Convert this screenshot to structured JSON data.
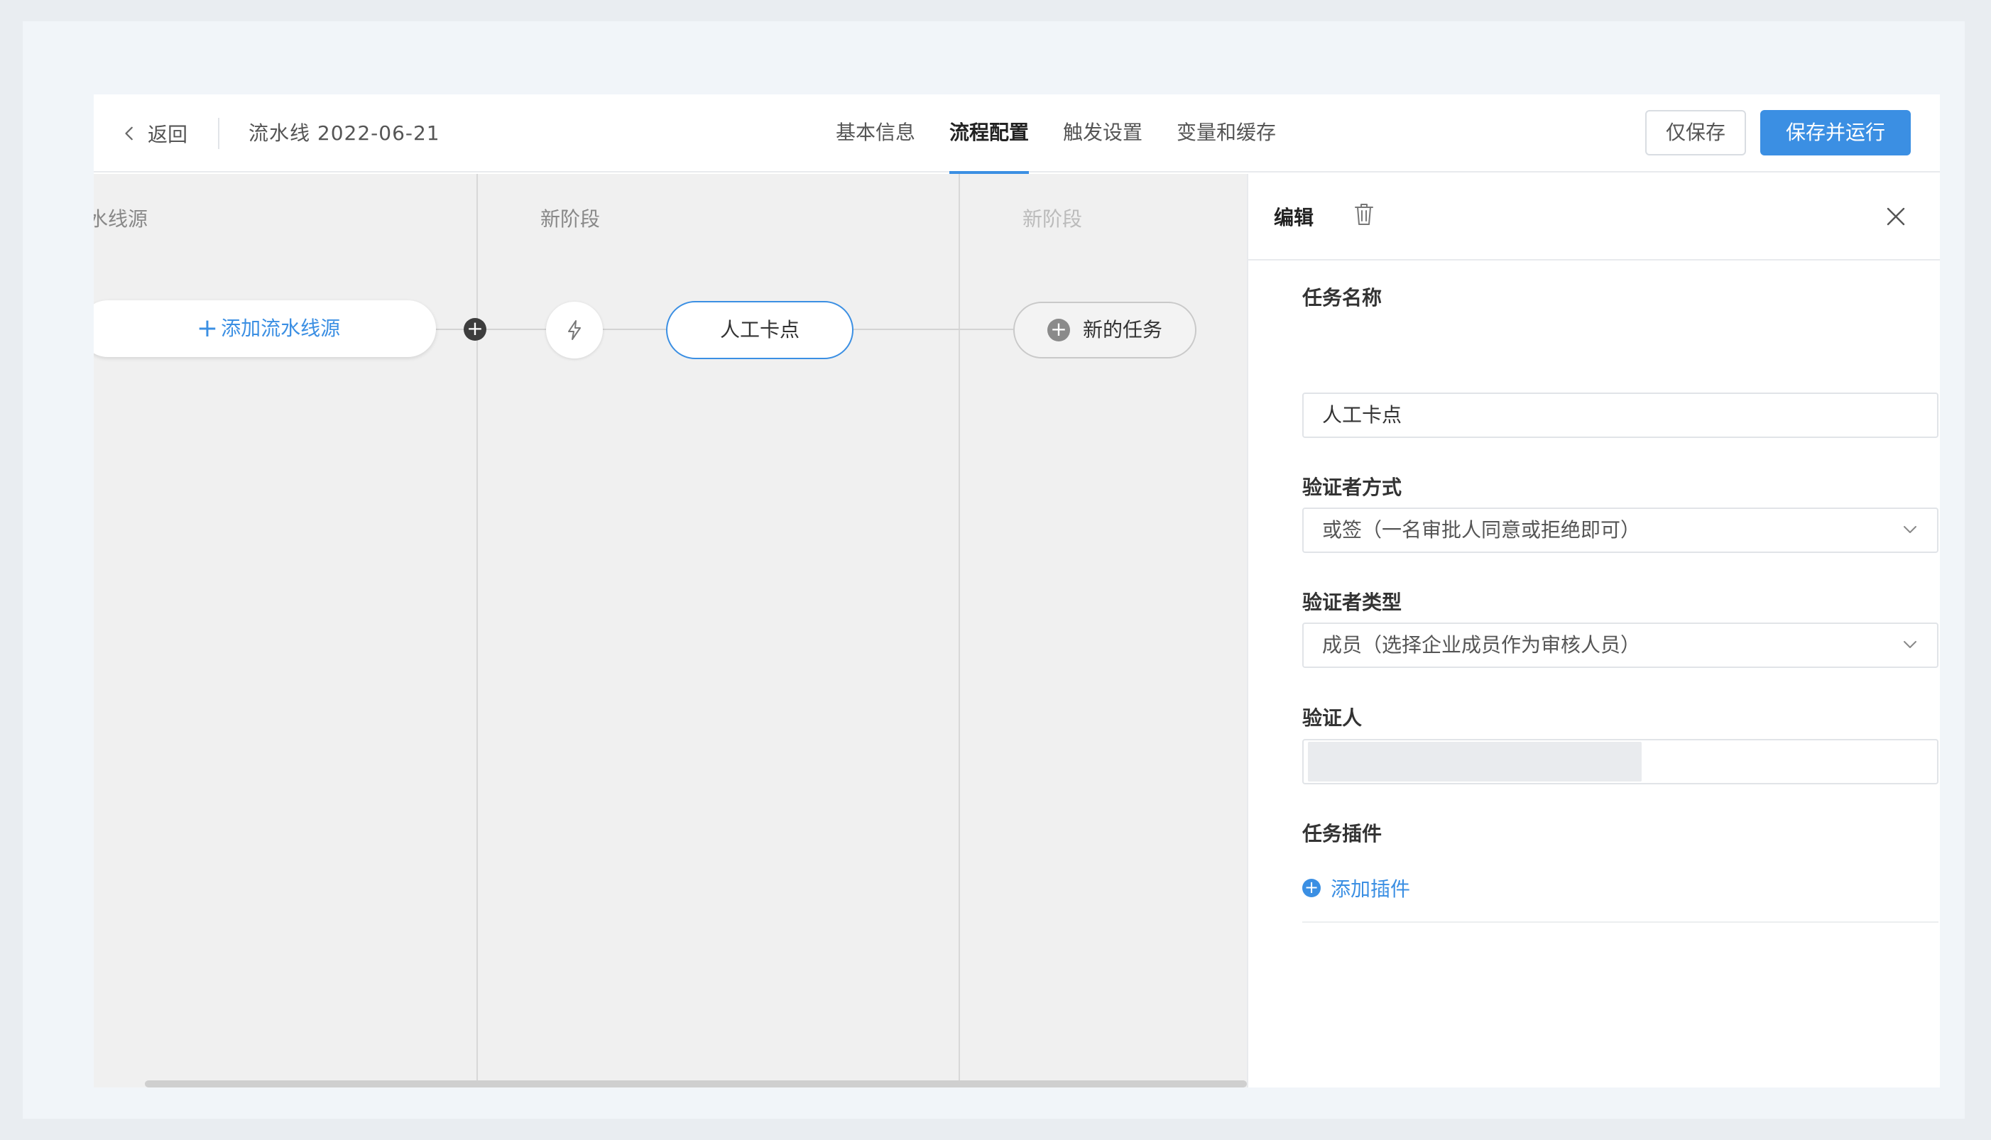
{
  "header": {
    "back_label": "返回",
    "pipeline_title": "流水线 2022-06-21",
    "tabs": [
      {
        "label": "基本信息",
        "active": false
      },
      {
        "label": "流程配置",
        "active": true
      },
      {
        "label": "触发设置",
        "active": false
      },
      {
        "label": "变量和缓存",
        "active": false
      }
    ],
    "save_label": "仅保存",
    "save_run_label": "保存并运行"
  },
  "canvas": {
    "stages": [
      {
        "title": "水线源"
      },
      {
        "title": "新阶段"
      },
      {
        "title": "新阶段"
      }
    ],
    "source_node_label": "添加流水线源",
    "task_node_label": "人工卡点",
    "new_task_label": "新的任务"
  },
  "panel": {
    "title": "编辑",
    "task_name": {
      "label": "任务名称",
      "value": "人工卡点"
    },
    "verifier_mode": {
      "label": "验证者方式",
      "value": "或签（一名审批人同意或拒绝即可）"
    },
    "verifier_type": {
      "label": "验证者类型",
      "value": "成员（选择企业成员作为审核人员）"
    },
    "verifier": {
      "label": "验证人",
      "value": ""
    },
    "plugins": {
      "label": "任务插件",
      "add_label": "添加插件"
    }
  },
  "colors": {
    "accent": "#3b8fe3",
    "canvas_bg": "#f0f0f0",
    "page_bg": "#f1f5f9"
  }
}
